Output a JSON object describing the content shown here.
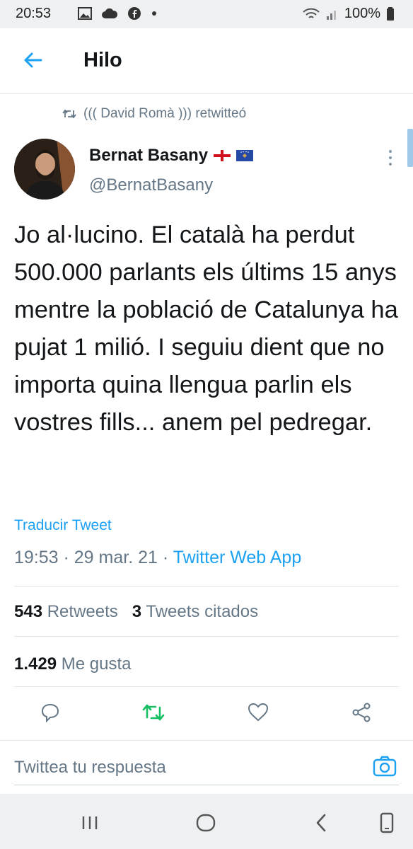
{
  "status_bar": {
    "time": "20:53",
    "battery": "100%",
    "icons": [
      "image-icon",
      "cloud-icon",
      "facebook-icon",
      "dot-icon",
      "wifi-icon",
      "signal-icon",
      "battery-icon"
    ]
  },
  "app_bar": {
    "title": "Hilo",
    "back_icon": "arrow-left-icon"
  },
  "tweet": {
    "retweeted_by": "((( David Romà ))) retwitteó",
    "author_name": "Bernat Basany",
    "author_handle": "@BernatBasany",
    "text": "Jo al·lucino. El català ha perdut 500.000 parlants els últims 15 anys mentre la població de Catalunya ha pujat 1 milió. I seguiu dient que no importa quina llengua parlin els vostres fills... anem pel pedregar.",
    "translate_label": "Traducir Tweet",
    "timestamp": "19:53 · 29 mar. 21 · ",
    "via": "Twitter Web App",
    "retweets_count": "543",
    "retweets_label": "Retweets",
    "quotes_count": "3",
    "quotes_label": "Tweets citados",
    "likes_count": "1.429",
    "likes_label": "Me gusta"
  },
  "reply": {
    "placeholder": "Twittea tu respuesta"
  },
  "colors": {
    "accent": "#1da1f2",
    "retweet_green": "#17bf63",
    "secondary_text": "#657786"
  }
}
